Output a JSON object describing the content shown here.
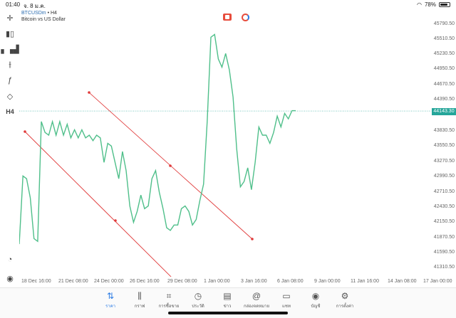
{
  "status_bar": {
    "time": "01:40",
    "date": "จ. 8 ม.ค.",
    "battery": "78%"
  },
  "symbol": {
    "name": "BTCUSDm",
    "timeframe": "H4",
    "description": "Bitcoin vs US Dollar",
    "separator": "•"
  },
  "timeframe_button": "H4",
  "current_price": "44143.30",
  "price_axis": [
    "45790.50",
    "45510.50",
    "45230.50",
    "44950.50",
    "44670.50",
    "44390.50",
    "43830.50",
    "43550.50",
    "43270.50",
    "42990.50",
    "42710.50",
    "42430.50",
    "42150.50",
    "41870.50",
    "41590.50",
    "41310.50"
  ],
  "time_axis": [
    "18 Dec 16:00",
    "21 Dec 08:00",
    "24 Dec 00:00",
    "26 Dec 16:00",
    "29 Dec 08:00",
    "1 Jan 00:00",
    "3 Jan 16:00",
    "6 Jan 08:00",
    "9 Jan 00:00",
    "11 Jan 16:00",
    "14 Jan 08:00",
    "17 Jan 00:00"
  ],
  "tabs": [
    {
      "label": "ราคา",
      "icon": "quotes-icon",
      "active": true
    },
    {
      "label": "กราฟ",
      "icon": "chart-icon",
      "active": false
    },
    {
      "label": "การซื้อขาย",
      "icon": "trade-icon",
      "active": false
    },
    {
      "label": "ประวัติ",
      "icon": "history-icon",
      "active": false
    },
    {
      "label": "ข่าว",
      "icon": "news-icon",
      "active": false
    },
    {
      "label": "กล่องจดหมาย",
      "icon": "mailbox-icon",
      "active": false
    },
    {
      "label": "แชท",
      "icon": "chat-icon",
      "active": false
    },
    {
      "label": "บัญชี",
      "icon": "account-icon",
      "active": false
    },
    {
      "label": "การตั้งค่า",
      "icon": "settings-icon",
      "active": false
    }
  ],
  "colors": {
    "line": "#4fbf8a",
    "trendline": "#e03a3a",
    "accent": "#2b7be4",
    "price_tag": "#26a69a"
  },
  "chart_data": {
    "type": "line",
    "series": [
      {
        "values": [
          41700,
          42950,
          42900,
          42550,
          41800,
          41750,
          43950,
          43750,
          43700,
          43950,
          43700,
          43950,
          43700,
          43900,
          43650,
          43800,
          43650,
          43800,
          43650,
          43700,
          43600,
          43700,
          43650,
          43200,
          43550,
          43500,
          43200,
          42900,
          43400,
          43050,
          42400,
          42100,
          42300,
          42600,
          42350,
          42400,
          42900,
          43050,
          42650,
          42350,
          42000,
          41950,
          42050,
          42050,
          42350,
          42400,
          42300,
          42050,
          42150,
          42500,
          42800,
          43950,
          45500,
          45550,
          45100,
          44950,
          45200,
          44900,
          44400,
          43450,
          42750,
          42850,
          43100,
          42700,
          43200,
          43850,
          43700,
          43700,
          43550,
          43750,
          44050,
          43850,
          44100,
          44000,
          44150,
          44150
        ]
      }
    ],
    "trendlines": [
      {
        "from": [
          "Dec 18 12:00",
          43800
        ],
        "to": [
          "Dec 29 00:00",
          41190
        ]
      },
      {
        "from": [
          "Dec 21 12:00",
          44500
        ],
        "to": [
          "Jan 3 08:00",
          42050
        ]
      }
    ],
    "ylim": [
      41100,
      46000
    ]
  }
}
